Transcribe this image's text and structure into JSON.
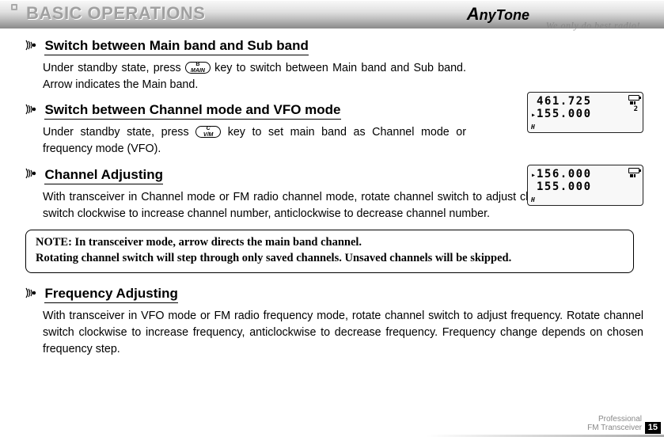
{
  "header": {
    "title": "BASIC OPERATIONS",
    "brand_prefix": "A",
    "brand_rest": "nyTone",
    "tagline": "We only do best radio!"
  },
  "sections": {
    "s1": {
      "heading": "Switch between Main band and Sub band",
      "text_a": "Under standby state, press ",
      "key_sup": "B",
      "key_main": "MAIN",
      "text_b": " key to switch between Main band and Sub band. Arrow indicates the Main band."
    },
    "s2": {
      "heading": "Switch between Channel mode and VFO mode",
      "text_a": "Under standby state, press ",
      "key_sup": "C",
      "key_main": "V/M",
      "text_b": " key to set main band as Channel mode or  frequency mode (VFO)."
    },
    "s3": {
      "heading": "Channel Adjusting",
      "text": "With transceiver in Channel mode or FM radio channel mode, rotate channel switch to adjust channel. Rotate channel switch clockwise to increase channel number, anticlockwise to decrease channel number."
    },
    "s4": {
      "heading": "Frequency Adjusting",
      "text": "With transceiver in VFO mode or FM radio frequency mode, rotate channel switch to adjust frequency. Rotate channel switch clockwise to increase frequency, anticlockwise to decrease frequency. Frequency change depends on chosen frequency step."
    }
  },
  "note": {
    "line1": "NOTE: In transceiver mode, arrow directs the main band channel.",
    "line2": "Rotating channel switch will step through only saved channels. Unsaved channels will be skipped."
  },
  "lcd1": {
    "line1": "461.725",
    "line2": "155.000",
    "right_digit": "2",
    "bl": "H"
  },
  "lcd2": {
    "line1": "156.000",
    "line2": "155.000",
    "bl": "H"
  },
  "footer": {
    "line1": "Professional",
    "line2": "FM Transceiver",
    "page": "15"
  }
}
